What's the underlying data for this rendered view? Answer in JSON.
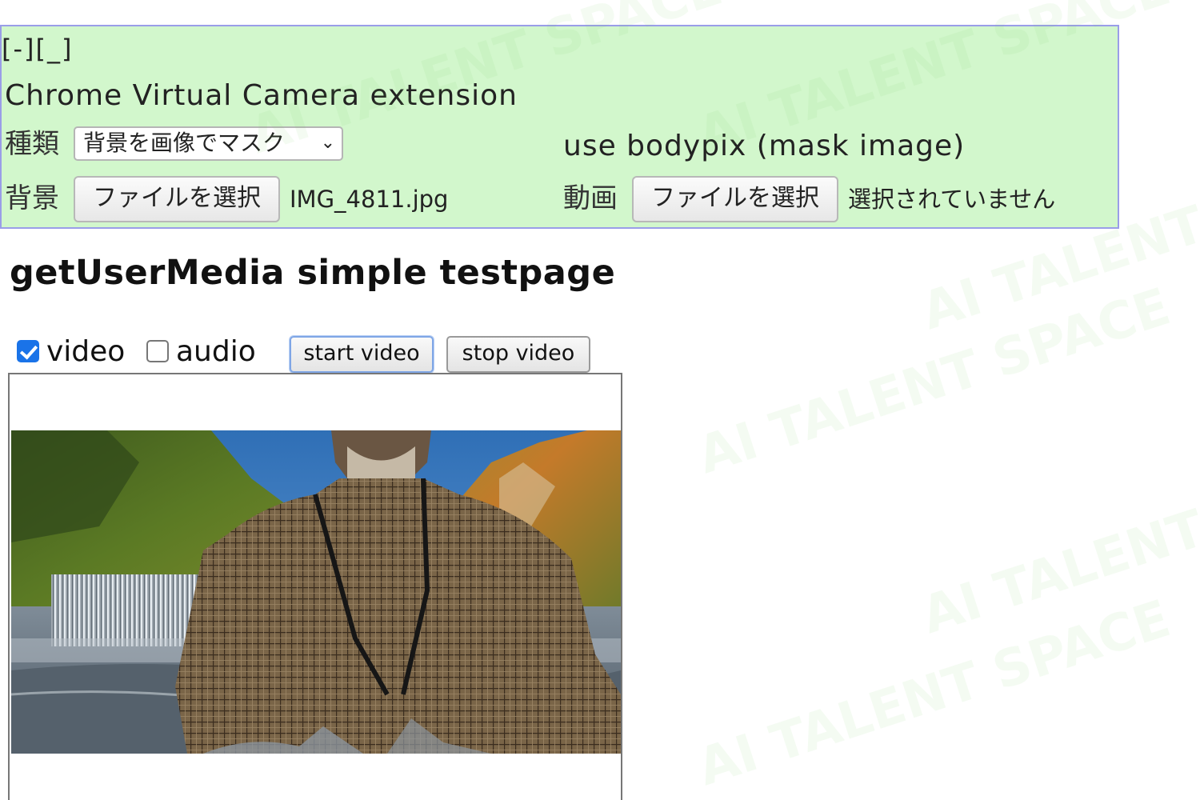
{
  "extension": {
    "collapse_control": "[-][_]",
    "title": "Chrome Virtual Camera extension",
    "type_label": "種類",
    "type_select_value": "背景を画像でマスク",
    "description": "use bodypix (mask image)",
    "background_label": "背景",
    "background_button": "ファイルを選択",
    "background_file": "IMG_4811.jpg",
    "video_label": "動画",
    "video_button": "ファイルを選択",
    "video_file": "選択されていません"
  },
  "page": {
    "title": "getUserMedia simple testpage"
  },
  "controls": {
    "video_label": "video",
    "video_checked": true,
    "audio_label": "audio",
    "audio_checked": false,
    "start_button": "start video",
    "stop_button": "stop video"
  },
  "watermark": {
    "text": "AI TALENT SPACE"
  },
  "colors": {
    "panel_background": "#d2f7cc",
    "panel_border": "#9a9ee8",
    "checkbox_accent": "#1a73e8",
    "watermark": "#78d25a"
  },
  "icons": {
    "select_arrow": "chevron-down-icon",
    "checkbox_checked": "checkmark-icon"
  }
}
